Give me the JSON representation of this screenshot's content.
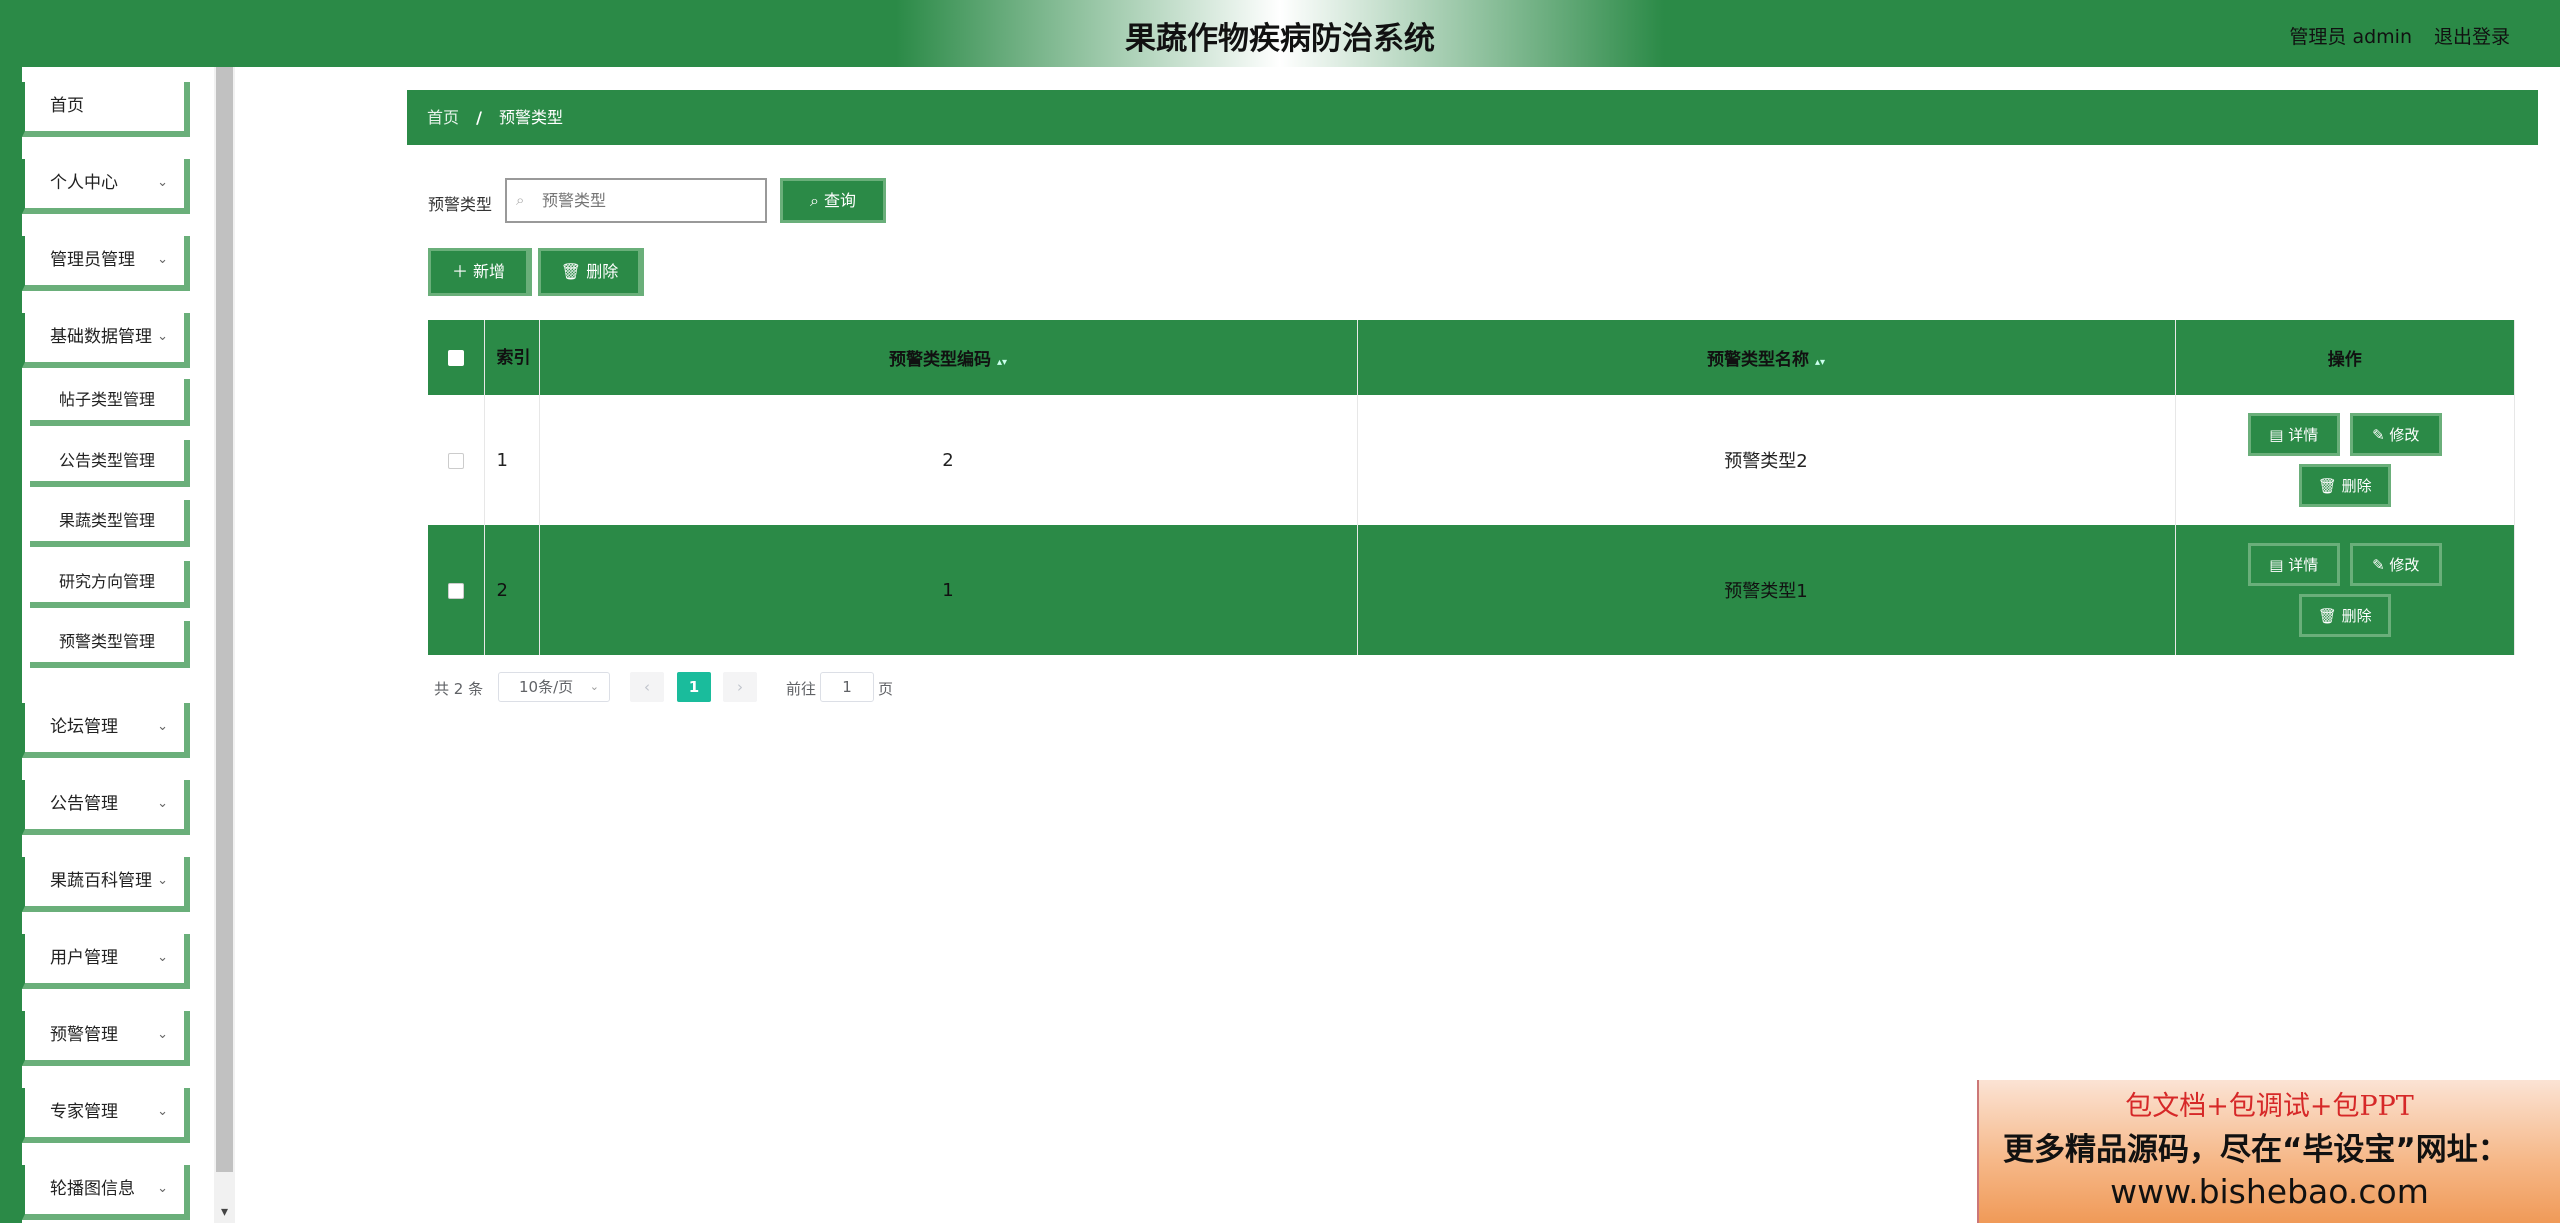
{
  "header": {
    "title": "果蔬作物疾病防治系统",
    "user": "管理员 admin",
    "logout": "退出登录"
  },
  "sidebar": {
    "items": [
      {
        "label": "首页",
        "has_children": false
      },
      {
        "label": "个人中心",
        "has_children": true
      },
      {
        "label": "管理员管理",
        "has_children": true
      },
      {
        "label": "基础数据管理",
        "has_children": true,
        "expanded": true,
        "children": [
          "帖子类型管理",
          "公告类型管理",
          "果蔬类型管理",
          "研究方向管理",
          "预警类型管理"
        ]
      },
      {
        "label": "论坛管理",
        "has_children": true
      },
      {
        "label": "公告管理",
        "has_children": true
      },
      {
        "label": "果蔬百科管理",
        "has_children": true
      },
      {
        "label": "用户管理",
        "has_children": true
      },
      {
        "label": "预警管理",
        "has_children": true
      },
      {
        "label": "专家管理",
        "has_children": true
      },
      {
        "label": "轮播图信息",
        "has_children": true
      }
    ],
    "chevron_glyph": "⌄"
  },
  "breadcrumb": {
    "home": "首页",
    "separator": "/",
    "current": "预警类型"
  },
  "search": {
    "label": "预警类型",
    "placeholder": "预警类型",
    "query_button": "查询",
    "search_glyph": "⌕"
  },
  "toolbar": {
    "add_button": "新增",
    "delete_button": "删除"
  },
  "table": {
    "columns": {
      "index": "索引",
      "code": "预警类型编码",
      "name": "预警类型名称",
      "actions": "操作"
    },
    "rows": [
      {
        "index": "1",
        "code": "2",
        "name": "预警类型2"
      },
      {
        "index": "2",
        "code": "1",
        "name": "预警类型1"
      }
    ],
    "row_actions": {
      "detail": "详情",
      "edit": "修改",
      "delete": "删除"
    }
  },
  "pagination": {
    "total": "共 2 条",
    "page_size": "10条/页",
    "current_page": "1",
    "goto_prefix": "前往",
    "goto_value": "1",
    "goto_suffix": "页"
  },
  "ad_banner": {
    "line1": "包文档+包调试+包PPT",
    "line2": "更多精品源码，尽在“毕设宝”网址：",
    "line3": "www.bishebao.com"
  },
  "colors": {
    "primary": "#2b8a47",
    "primary_light": "#6aaf7a",
    "pager_active": "#1abc9c"
  }
}
